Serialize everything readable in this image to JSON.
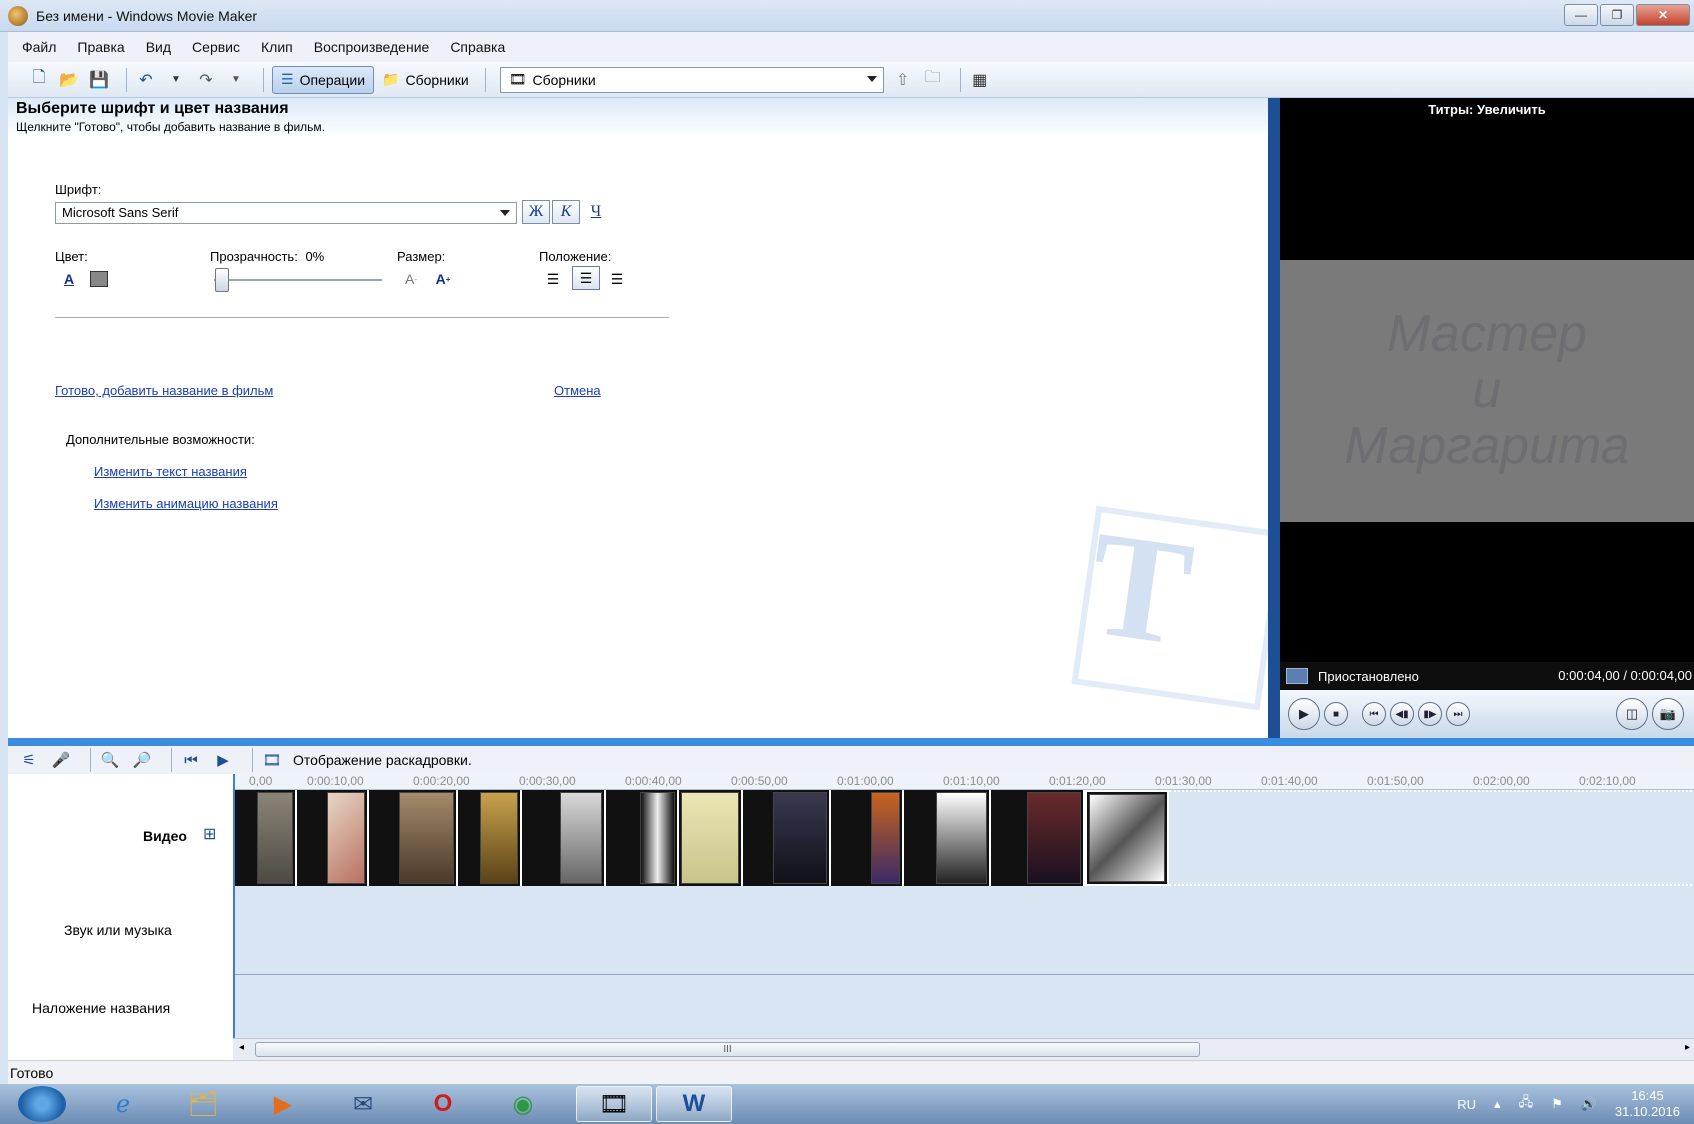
{
  "window": {
    "title": "Без имени - Windows Movie Maker",
    "min": "—",
    "max": "❐",
    "close": "✕"
  },
  "menu": [
    "Файл",
    "Правка",
    "Вид",
    "Сервис",
    "Клип",
    "Воспроизведение",
    "Справка"
  ],
  "toolbar": {
    "operations": "Операции",
    "collections": "Сборники",
    "combo_value": "Сборники"
  },
  "task": {
    "title": "Выберите шрифт и цвет названия",
    "subtitle": "Щелкните \"Готово\", чтобы добавить название в фильм.",
    "font_label": "Шрифт:",
    "font_value": "Microsoft Sans Serif",
    "bold": "Ж",
    "italic": "К",
    "underline": "Ч",
    "color_label": "Цвет:",
    "transparency_label": "Прозрачность:",
    "transparency_value": "0%",
    "transparency_level": 0,
    "size_label": "Размер:",
    "position_label": "Положение:",
    "done_link": "Готово, добавить название в фильм",
    "cancel_link": "Отмена",
    "more_label": "Дополнительные возможности:",
    "edit_text_link": "Изменить текст названия",
    "edit_anim_link": "Изменить анимацию названия",
    "watermark": "T"
  },
  "monitor": {
    "title": "Титры: Увеличить",
    "text_lines": [
      "Мастер",
      "и",
      "Маргарита"
    ],
    "status": "Приостановлено",
    "time": "0:00:04,00 / 0:00:04,00"
  },
  "timeline": {
    "view_label": "Отображение раскадровки.",
    "ticks": [
      "0,00",
      "0:00:10,00",
      "0:00:20,00",
      "0:00:30,00",
      "0:00:40,00",
      "0:00:50,00",
      "0:01:00,00",
      "0:01:10,00",
      "0:01:20,00",
      "0:01:30,00",
      "0:01:40,00",
      "0:01:50,00",
      "0:02:00,00",
      "0:02:10,00"
    ],
    "video_track": "Видео",
    "expand": "⊞",
    "audio_track": "Звук или музыка",
    "title_track": "Наложение названия",
    "scroll_grip": "III"
  },
  "status_bar": "Готово",
  "tray": {
    "lang": "RU",
    "time": "16:45",
    "date": "31.10.2016"
  },
  "colors": {
    "accent": "#3b8de0",
    "link": "#1a3fb0"
  }
}
